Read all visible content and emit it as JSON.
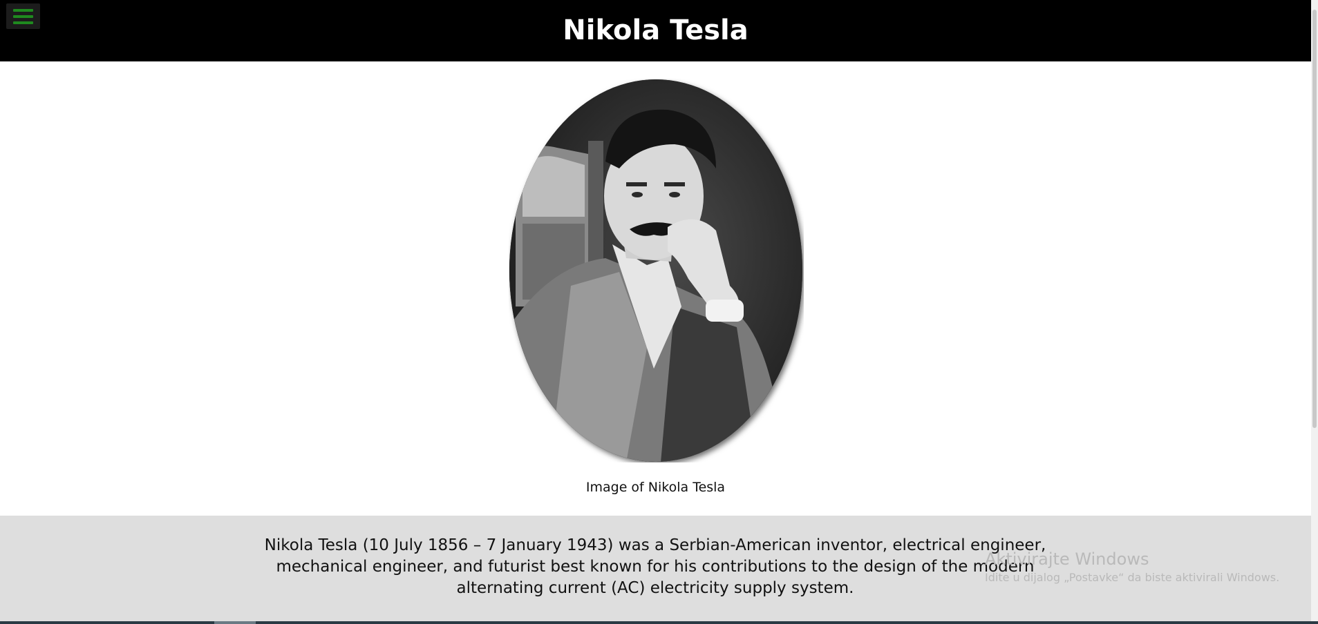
{
  "header": {
    "title": "Nikola Tesla",
    "menu_icon": "hamburger-menu-icon"
  },
  "main": {
    "image_alt": "Nikola Tesla portrait",
    "caption": "Image of Nikola Tesla"
  },
  "info": {
    "text": "Nikola Tesla (10 July 1856 – 7 January 1943) was a Serbian-American inventor, electrical engineer, mechanical engineer, and futurist best known for his contributions to the design of the modern alternating current (AC) electricity supply system."
  },
  "watermark": {
    "title": "Aktivirajte Windows",
    "subtitle": "Idite u dijalog „Postavke“ da biste aktivirali Windows."
  },
  "colors": {
    "header_bg": "#000000",
    "menu_icon": "#1f8a1f",
    "info_bg": "#dedede"
  }
}
